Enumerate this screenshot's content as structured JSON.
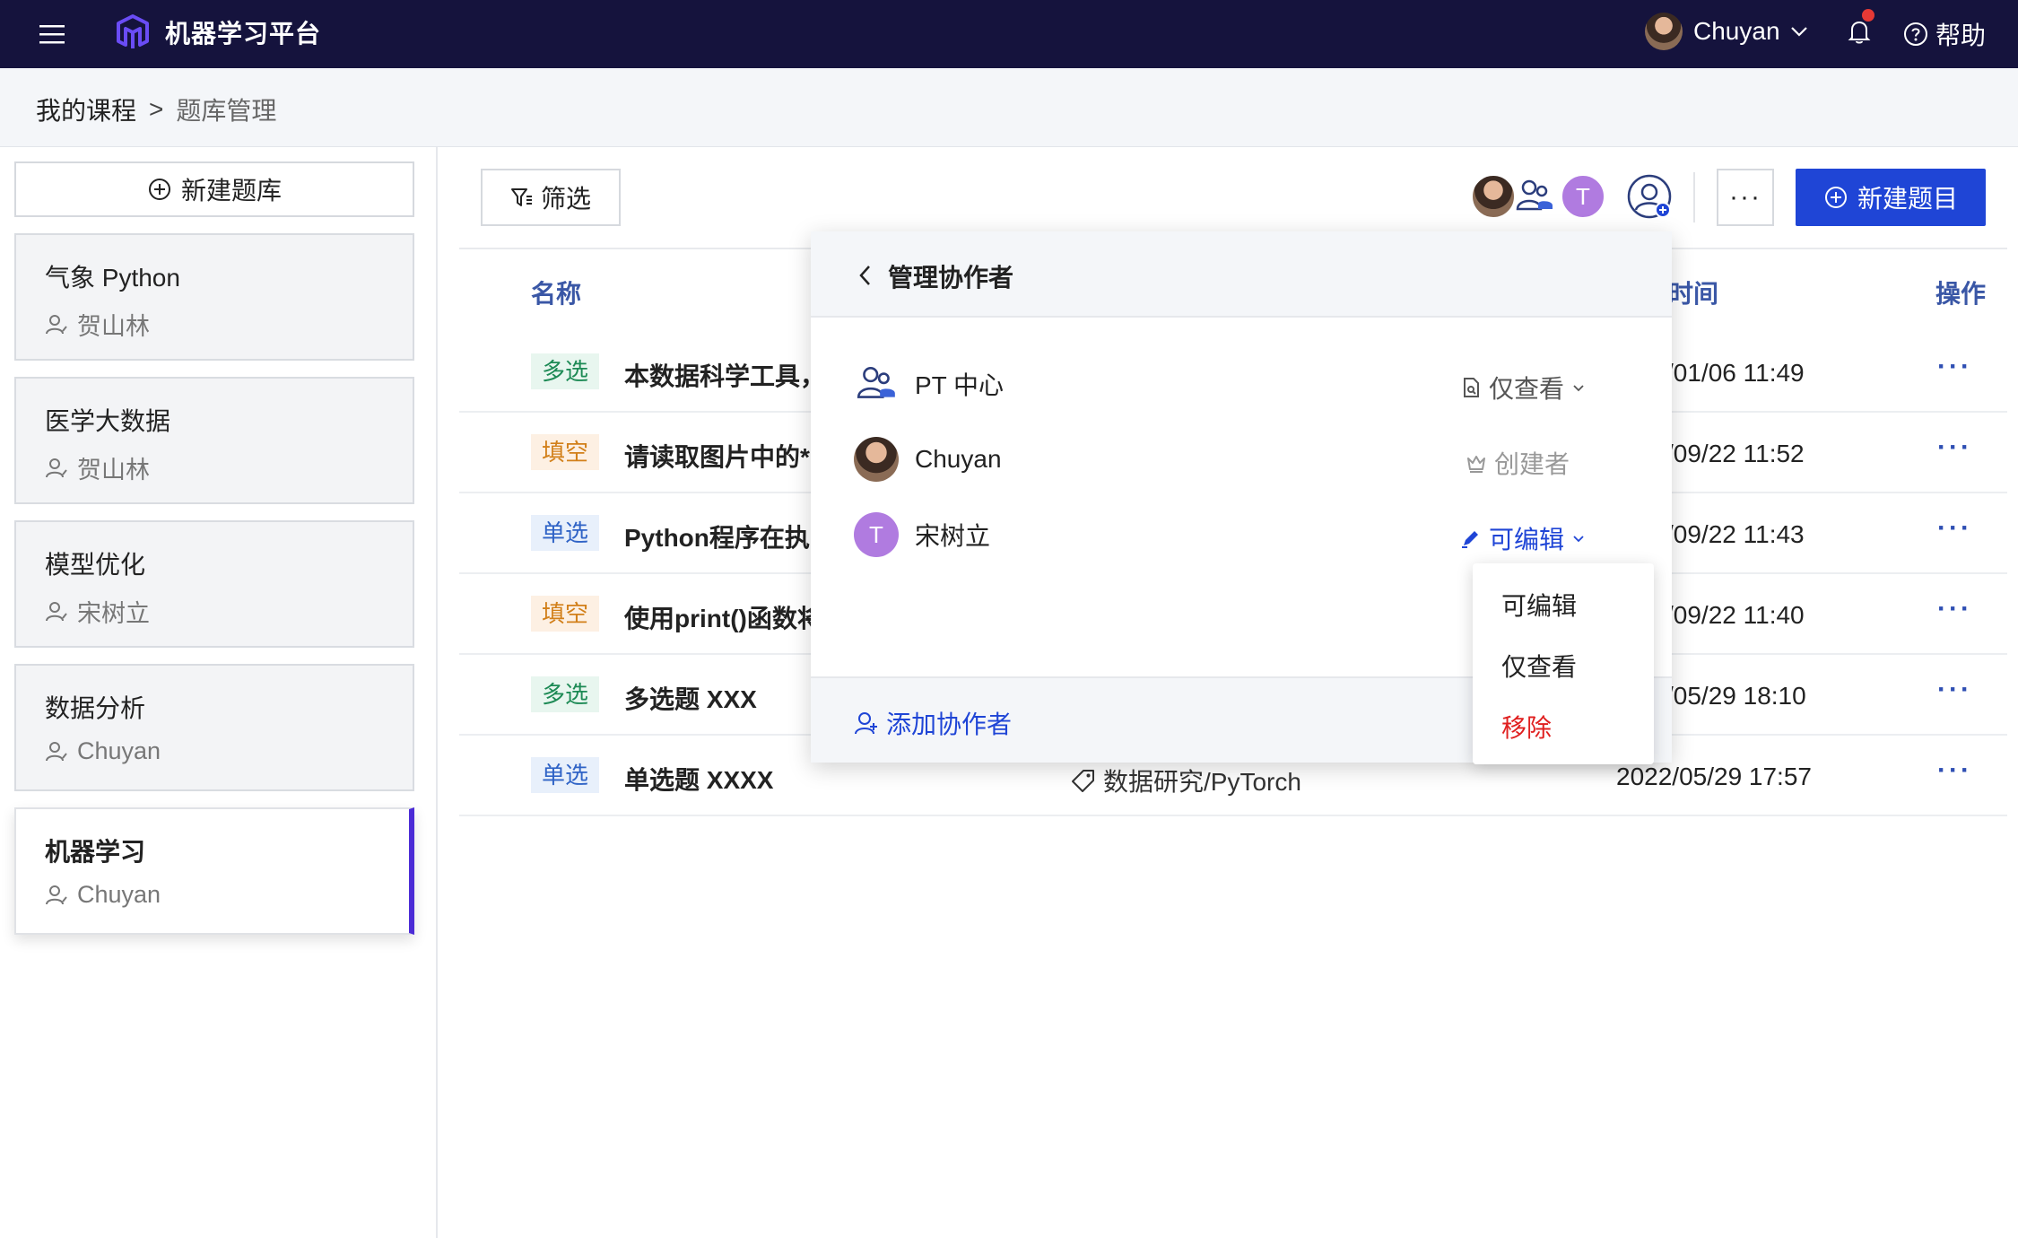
{
  "app": {
    "title": "机器学习平台"
  },
  "user": {
    "name": "Chuyan"
  },
  "header": {
    "help_label": "帮助"
  },
  "breadcrumb": {
    "parent": "我的课程",
    "separator": ">",
    "current": "题库管理"
  },
  "sidebar": {
    "new_bank_label": "新建题库",
    "banks": [
      {
        "title": "气象 Python",
        "owner": "贺山林"
      },
      {
        "title": "医学大数据",
        "owner": "贺山林"
      },
      {
        "title": "模型优化",
        "owner": "宋树立"
      },
      {
        "title": "数据分析",
        "owner": "Chuyan"
      },
      {
        "title": "机器学习",
        "owner": "Chuyan"
      }
    ],
    "active_index": 4
  },
  "toolbar": {
    "filter_label": "筛选",
    "collab_initial": "T",
    "more_label": "···",
    "new_question_label": "新建题目"
  },
  "table": {
    "headers": {
      "name": "名称",
      "time": "时间",
      "actions": "操作"
    },
    "rows": [
      {
        "type": "多选",
        "title": "本数据科学工具，",
        "tag": "",
        "time": "/01/06 11:49"
      },
      {
        "type": "填空",
        "title": "请读取图片中的*",
        "tag": "",
        "time": "/09/22 11:52"
      },
      {
        "type": "单选",
        "title": "Python程序在执",
        "tag": "",
        "time": "/09/22 11:43"
      },
      {
        "type": "填空",
        "title": "使用print()函数将",
        "tag": "",
        "time": "/09/22 11:40"
      },
      {
        "type": "多选",
        "title": "多选题 XXX",
        "tag": "",
        "time": "/05/29 18:10"
      },
      {
        "type": "单选",
        "title": "单选题 XXXX",
        "tag": "数据研究/PyTorch",
        "time": "2022/05/29 17:57"
      }
    ],
    "row_action": "···"
  },
  "collaborators_panel": {
    "title": "管理协作者",
    "members": [
      {
        "name": "PT 中心",
        "role": "仅查看"
      },
      {
        "name": "Chuyan",
        "role": "创建者"
      },
      {
        "name": "宋树立",
        "initial": "T",
        "role": "可编辑"
      }
    ],
    "add_label": "添加协作者"
  },
  "role_dropdown": {
    "options": [
      "可编辑",
      "仅查看",
      "移除"
    ]
  },
  "colors": {
    "topbar": "#15133d",
    "primary": "#1f45d6",
    "accent_purple": "#4b2bd6",
    "danger": "#e02020",
    "avatar_t": "#b07be0"
  }
}
